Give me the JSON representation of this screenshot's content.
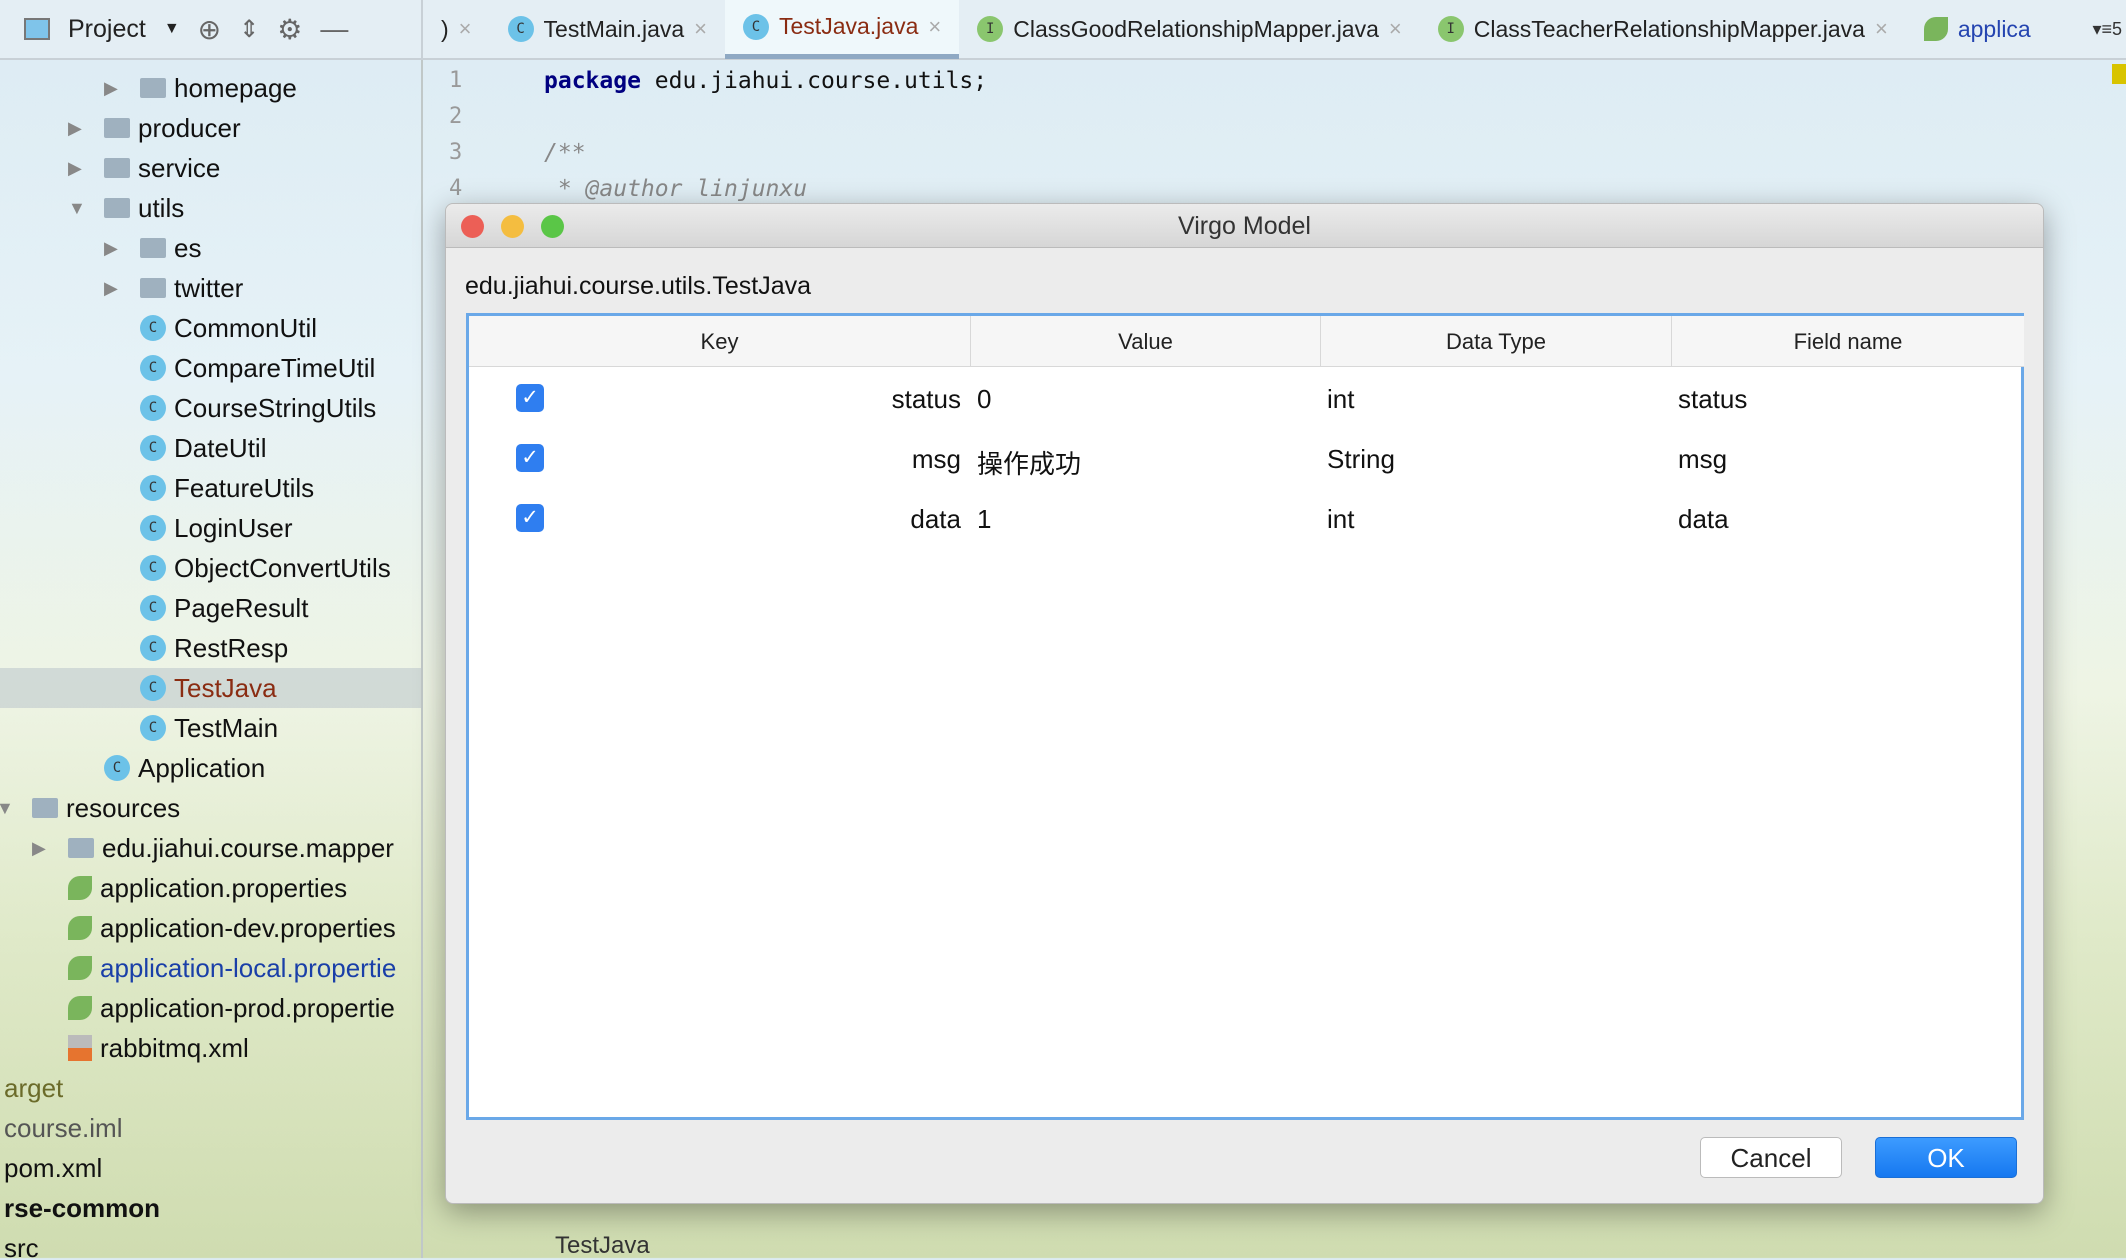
{
  "tabbar": {
    "project_label": "Project",
    "tabs": [
      {
        "label": ")",
        "icon": "",
        "active": false
      },
      {
        "label": "TestMain.java",
        "icon": "c",
        "active": false
      },
      {
        "label": "TestJava.java",
        "icon": "c",
        "active": true
      },
      {
        "label": "ClassGoodRelationshipMapper.java",
        "icon": "i",
        "active": false
      },
      {
        "label": "ClassTeacherRelationshipMapper.java",
        "icon": "i",
        "active": false
      },
      {
        "label": "applica",
        "icon": "spring",
        "active": false
      }
    ],
    "overflow_count": "5"
  },
  "tree": [
    {
      "label": "homepage",
      "indent": 176,
      "type": "folder",
      "arrow": "right"
    },
    {
      "label": "producer",
      "indent": 140,
      "type": "folder",
      "arrow": "right"
    },
    {
      "label": "service",
      "indent": 140,
      "type": "folder",
      "arrow": "right"
    },
    {
      "label": "utils",
      "indent": 140,
      "type": "folder",
      "arrow": "down"
    },
    {
      "label": "es",
      "indent": 176,
      "type": "folder",
      "arrow": "right"
    },
    {
      "label": "twitter",
      "indent": 176,
      "type": "folder",
      "arrow": "right"
    },
    {
      "label": "CommonUtil",
      "indent": 176,
      "type": "class"
    },
    {
      "label": "CompareTimeUtil",
      "indent": 176,
      "type": "class"
    },
    {
      "label": "CourseStringUtils",
      "indent": 176,
      "type": "class"
    },
    {
      "label": "DateUtil",
      "indent": 176,
      "type": "class"
    },
    {
      "label": "FeatureUtils",
      "indent": 176,
      "type": "class"
    },
    {
      "label": "LoginUser",
      "indent": 176,
      "type": "class"
    },
    {
      "label": "ObjectConvertUtils",
      "indent": 176,
      "type": "class"
    },
    {
      "label": "PageResult",
      "indent": 176,
      "type": "class"
    },
    {
      "label": "RestResp",
      "indent": 176,
      "type": "class"
    },
    {
      "label": "TestJava",
      "indent": 176,
      "type": "class",
      "selected": true
    },
    {
      "label": "TestMain",
      "indent": 176,
      "type": "class"
    },
    {
      "label": "Application",
      "indent": 140,
      "type": "class"
    },
    {
      "label": "resources",
      "indent": 68,
      "type": "folder",
      "arrow": "down"
    },
    {
      "label": "edu.jiahui.course.mapper",
      "indent": 104,
      "type": "folder",
      "arrow": "right"
    },
    {
      "label": "application.properties",
      "indent": 104,
      "type": "props"
    },
    {
      "label": "application-dev.properties",
      "indent": 104,
      "type": "props"
    },
    {
      "label": "application-local.propertie",
      "indent": 104,
      "type": "props",
      "color": "#1a3fa8"
    },
    {
      "label": "application-prod.propertie",
      "indent": 104,
      "type": "props"
    },
    {
      "label": "rabbitmq.xml",
      "indent": 104,
      "type": "xml"
    },
    {
      "label": "arget",
      "indent": 4,
      "type": "none",
      "color": "#6b6b2a"
    },
    {
      "label": "course.iml",
      "indent": 4,
      "type": "none",
      "color": "#555"
    },
    {
      "label": "pom.xml",
      "indent": 4,
      "type": "none"
    },
    {
      "label": "rse-common",
      "indent": 4,
      "type": "none",
      "bold": true
    },
    {
      "label": "src",
      "indent": 4,
      "type": "none"
    }
  ],
  "editor": {
    "lines": [
      {
        "n": "1",
        "kw": "package",
        "text": " edu.jiahui.course.utils;"
      },
      {
        "n": "2",
        "kw": "",
        "text": ""
      },
      {
        "n": "3",
        "kw": "",
        "text": "/**"
      },
      {
        "n": "4",
        "kw": "",
        "text": " * @author linjunxu"
      }
    ]
  },
  "dialog": {
    "title": "Virgo Model",
    "class_name": "edu.jiahui.course.utils.TestJava",
    "columns": [
      "Key",
      "Value",
      "Data Type",
      "Field name"
    ],
    "rows": [
      {
        "checked": true,
        "key": "status",
        "value": "0",
        "type": "int",
        "field": "status"
      },
      {
        "checked": true,
        "key": "msg",
        "value": "操作成功",
        "type": "String",
        "field": "msg"
      },
      {
        "checked": true,
        "key": "data",
        "value": "1",
        "type": "int",
        "field": "data"
      }
    ],
    "cancel": "Cancel",
    "ok": "OK"
  },
  "status": {
    "breadcrumb": "TestJava"
  }
}
